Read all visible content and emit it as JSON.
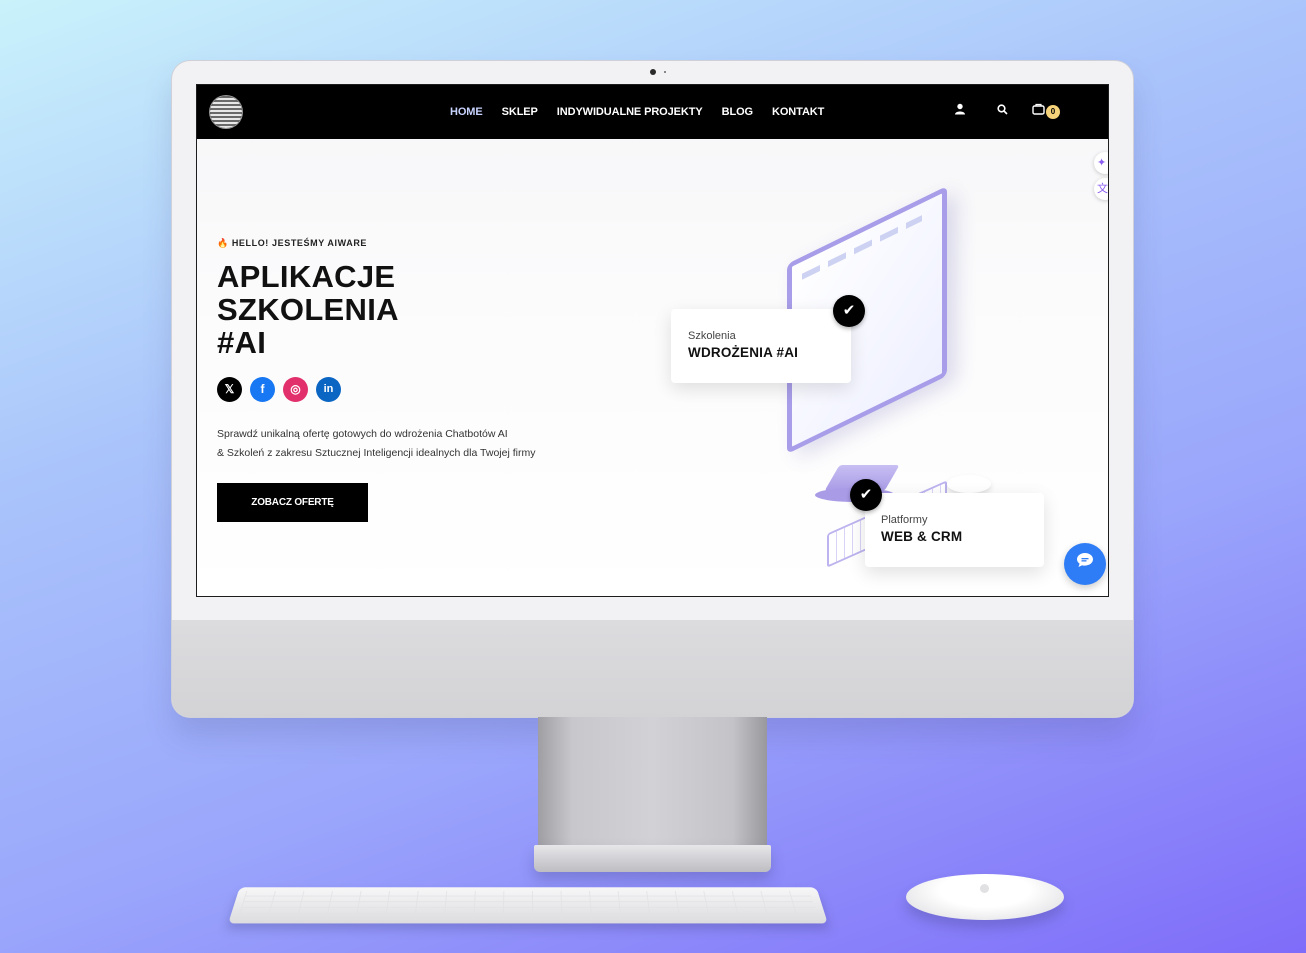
{
  "nav": {
    "items": [
      {
        "label": "HOME",
        "active": true
      },
      {
        "label": "SKLEP"
      },
      {
        "label": "INDYWIDUALNE PROJEKTY"
      },
      {
        "label": "BLOG"
      },
      {
        "label": "KONTAKT"
      }
    ],
    "icons": [
      "user-icon",
      "search-icon",
      "cart-icon"
    ],
    "cart_count": "0"
  },
  "hero": {
    "eyebrow": "HELLO! JESTEŚMY AIWARE",
    "title_lines": [
      "APLIKACJE",
      "SZKOLENIA",
      "#AI"
    ],
    "description_line1": "Sprawdź unikalną ofertę gotowych do wdrożenia Chatbotów AI",
    "description_line2": "& Szkoleń z zakresu Sztucznej Inteligencji idealnych dla Twojej firmy",
    "cta_label": "ZOBACZ OFERTĘ"
  },
  "socials": [
    {
      "name": "x-icon",
      "glyph": "𝕏",
      "color": "#000000"
    },
    {
      "name": "facebook-icon",
      "glyph": "f",
      "color": "#1877f2"
    },
    {
      "name": "instagram-icon",
      "glyph": "◎",
      "color": "#e1306c"
    },
    {
      "name": "linkedin-icon",
      "glyph": "in",
      "color": "#0a66c2"
    }
  ],
  "cards": {
    "card1": {
      "small": "Szkolenia",
      "big": "WDROŻENIA #AI"
    },
    "card2": {
      "small": "Platformy",
      "big": "WEB & CRM"
    }
  },
  "colors": {
    "accent": "#2f7df6",
    "nav_bg": "#000000",
    "illustration": "#a79de8"
  }
}
